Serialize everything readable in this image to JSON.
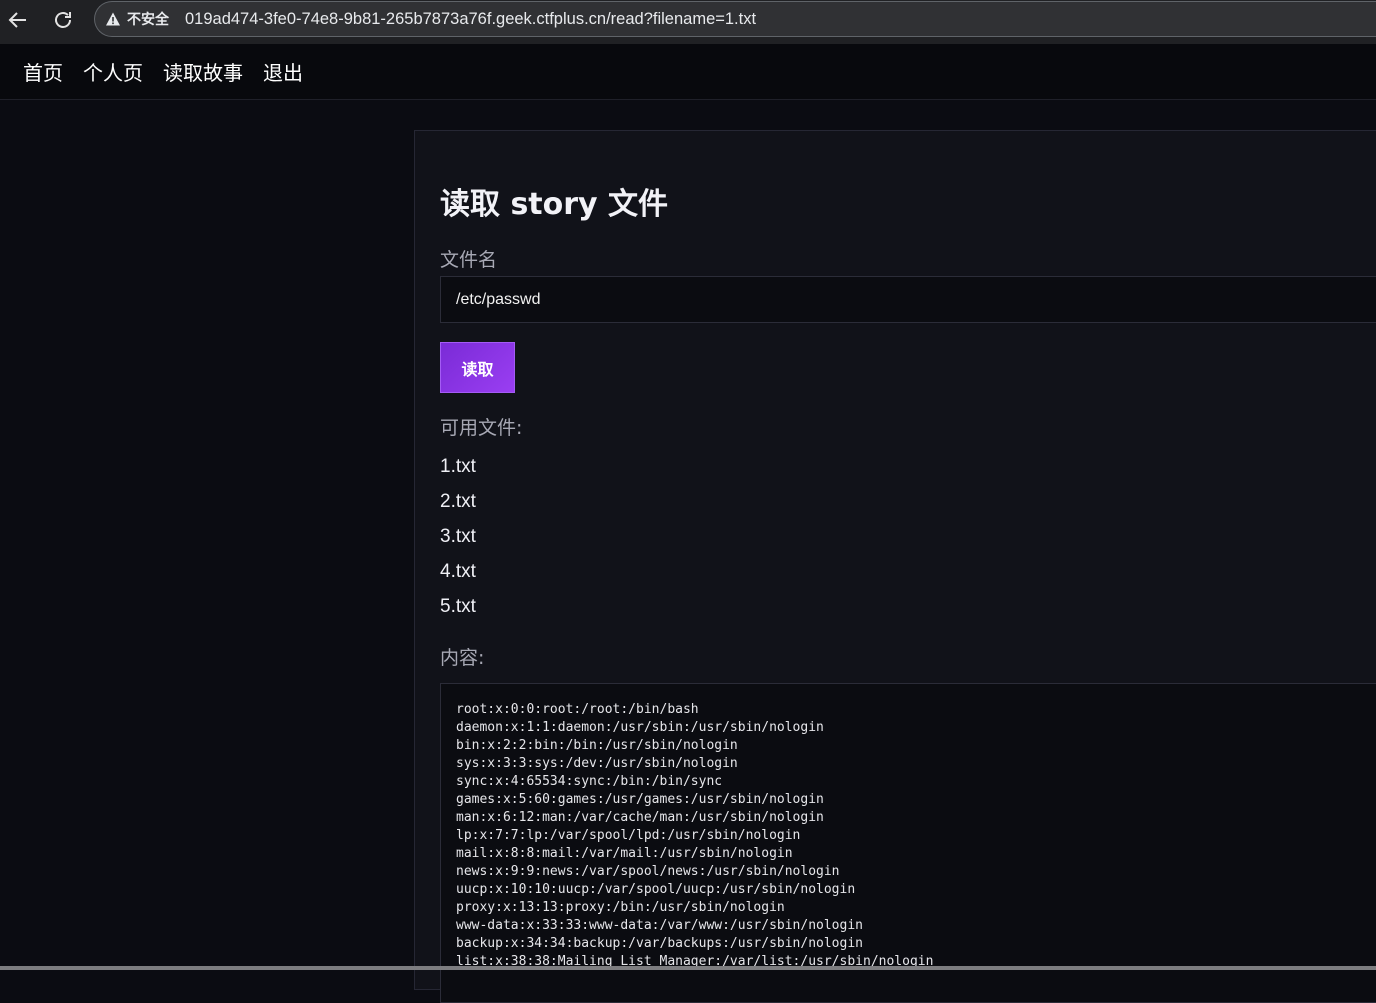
{
  "browser": {
    "security_label": "不安全",
    "url": "019ad474-3fe0-74e8-9b81-265b7873a76f.geek.ctfplus.cn/read?filename=1.txt"
  },
  "nav": {
    "items": [
      "首页",
      "个人页",
      "读取故事",
      "退出"
    ]
  },
  "page": {
    "title": "读取 story 文件",
    "filename_label": "文件名",
    "filename_value": "/etc/passwd",
    "read_button": "读取",
    "files_label": "可用文件:",
    "files": [
      "1.txt",
      "2.txt",
      "3.txt",
      "4.txt",
      "5.txt"
    ],
    "content_label": "内容:",
    "content_lines": [
      "root:x:0:0:root:/root:/bin/bash",
      "daemon:x:1:1:daemon:/usr/sbin:/usr/sbin/nologin",
      "bin:x:2:2:bin:/bin:/usr/sbin/nologin",
      "sys:x:3:3:sys:/dev:/usr/sbin/nologin",
      "sync:x:4:65534:sync:/bin:/bin/sync",
      "games:x:5:60:games:/usr/games:/usr/sbin/nologin",
      "man:x:6:12:man:/var/cache/man:/usr/sbin/nologin",
      "lp:x:7:7:lp:/var/spool/lpd:/usr/sbin/nologin",
      "mail:x:8:8:mail:/var/mail:/usr/sbin/nologin",
      "news:x:9:9:news:/var/spool/news:/usr/sbin/nologin",
      "uucp:x:10:10:uucp:/var/spool/uucp:/usr/sbin/nologin",
      "proxy:x:13:13:proxy:/bin:/usr/sbin/nologin",
      "www-data:x:33:33:www-data:/var/www:/usr/sbin/nologin",
      "backup:x:34:34:backup:/var/backups:/usr/sbin/nologin",
      "list:x:38:38:Mailing List Manager:/var/list:/usr/sbin/nologin"
    ]
  },
  "colors": {
    "accent": "#8a34e6",
    "background": "#0b0c12",
    "card": "#111219"
  },
  "icons": {
    "back": "back-arrow-icon",
    "reload": "reload-icon",
    "warning": "warning-icon"
  }
}
